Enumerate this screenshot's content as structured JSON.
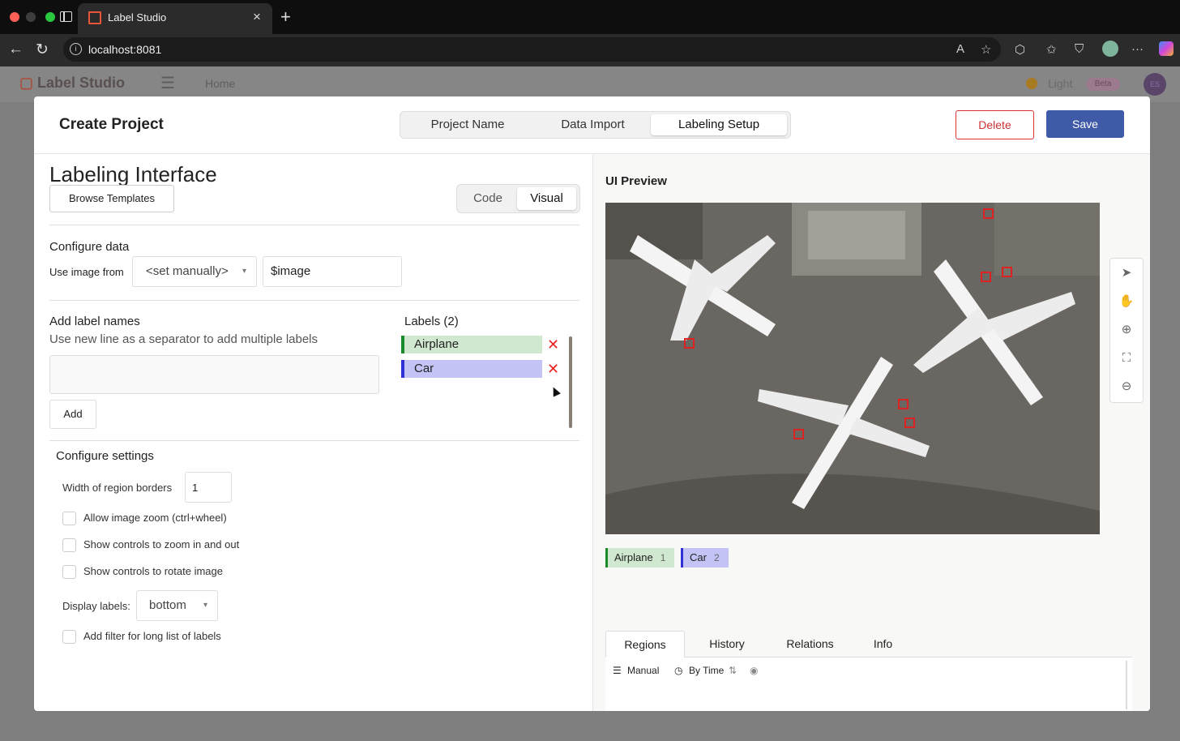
{
  "browser": {
    "tab_title": "Label Studio",
    "tab_close": "×",
    "new_tab": "+",
    "url": "localhost:8081"
  },
  "background_app": {
    "logo": "Label Studio",
    "nav_home": "Home",
    "theme_label": "Light",
    "theme_badge": "Beta",
    "avatar": "ES"
  },
  "modal": {
    "title": "Create Project",
    "steps": [
      "Project Name",
      "Data Import",
      "Labeling Setup"
    ],
    "active_step": "Labeling Setup",
    "delete_label": "Delete",
    "save_label": "Save"
  },
  "config": {
    "heading": "Labeling Interface",
    "browse_label": "Browse Templates",
    "mode_code": "Code",
    "mode_visual": "Visual",
    "configure_data": "Configure data",
    "use_image_from": "Use image from",
    "source_select": "<set manually>",
    "source_value": "$image",
    "add_label_names": "Add label names",
    "add_label_hint": "Use new line as a separator to add multiple labels",
    "add_button": "Add",
    "labels_heading": "Labels (2)",
    "labels": [
      {
        "name": "Airplane",
        "color": "#1a8a2a"
      },
      {
        "name": "Car",
        "color": "#3030d8"
      }
    ],
    "configure_settings": "Configure settings",
    "border_width_label": "Width of region borders",
    "border_width_value": "1",
    "opt_zoom": "Allow image zoom (ctrl+wheel)",
    "opt_zoom_controls": "Show controls to zoom in and out",
    "opt_rotate": "Show controls to rotate image",
    "display_labels_label": "Display labels:",
    "display_labels_value": "bottom",
    "opt_filter": "Add filter for long list of labels"
  },
  "preview": {
    "title": "UI Preview",
    "labels": [
      {
        "name": "Airplane",
        "hotkey": "1"
      },
      {
        "name": "Car",
        "hotkey": "2"
      }
    ],
    "tabs": [
      "Regions",
      "History",
      "Relations",
      "Info"
    ],
    "active_tab": "Regions",
    "sort_manual": "Manual",
    "sort_time": "By Time",
    "tools": [
      "pointer-icon",
      "pan-icon",
      "zoom-in-icon",
      "fit-icon",
      "zoom-out-icon"
    ]
  }
}
